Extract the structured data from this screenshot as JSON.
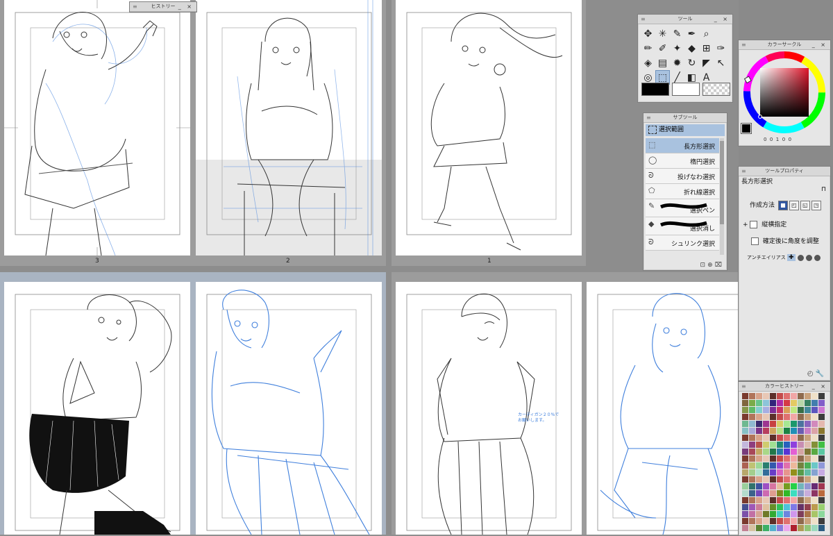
{
  "panels": {
    "history": {
      "title": "ヒストリー",
      "controls": "_ ×"
    },
    "tool": {
      "title": "ツール",
      "controls": "_ ×"
    },
    "color_circle": {
      "title": "カラーサークル",
      "controls": "_ ×",
      "readout": "0  0  1  0  0"
    },
    "subtool": {
      "title": "サブツール",
      "group_label": "選択範囲",
      "items": [
        {
          "label": "長方形選択",
          "icon": "rect-select-icon",
          "selected": true
        },
        {
          "label": "楕円選択",
          "icon": "ellipse-select-icon",
          "selected": false
        },
        {
          "label": "投げなわ選択",
          "icon": "lasso-icon",
          "selected": false
        },
        {
          "label": "折れ線選択",
          "icon": "polyline-icon",
          "selected": false
        },
        {
          "label": "選択ペン",
          "icon": "pen-icon",
          "selected": false
        },
        {
          "label": "選択消し",
          "icon": "eraser-icon",
          "selected": false
        },
        {
          "label": "シュリンク選択",
          "icon": "shrink-icon",
          "selected": false
        }
      ]
    },
    "tool_property": {
      "title": "ツールプロパティ",
      "tool_name": "長方形選択",
      "creation_method_label": "作成方法",
      "aspect_label": "縦横指定",
      "angle_label": "確定後に角度を調整",
      "antialias_label": "アンチエイリアス"
    },
    "color_history": {
      "title": "カラーヒストリー",
      "controls": "_ ×"
    }
  },
  "pages": [
    {
      "number": "3"
    },
    {
      "number": "2"
    },
    {
      "number": "1"
    }
  ],
  "annotation": {
    "line1": "カーディガン２０%で",
    "line2": "お願いします。"
  },
  "colors": {
    "main_color": "#000000",
    "sub_color": "#ffffff",
    "accent": "#a9c2df",
    "sketch_blue": "#3f7fdc"
  }
}
